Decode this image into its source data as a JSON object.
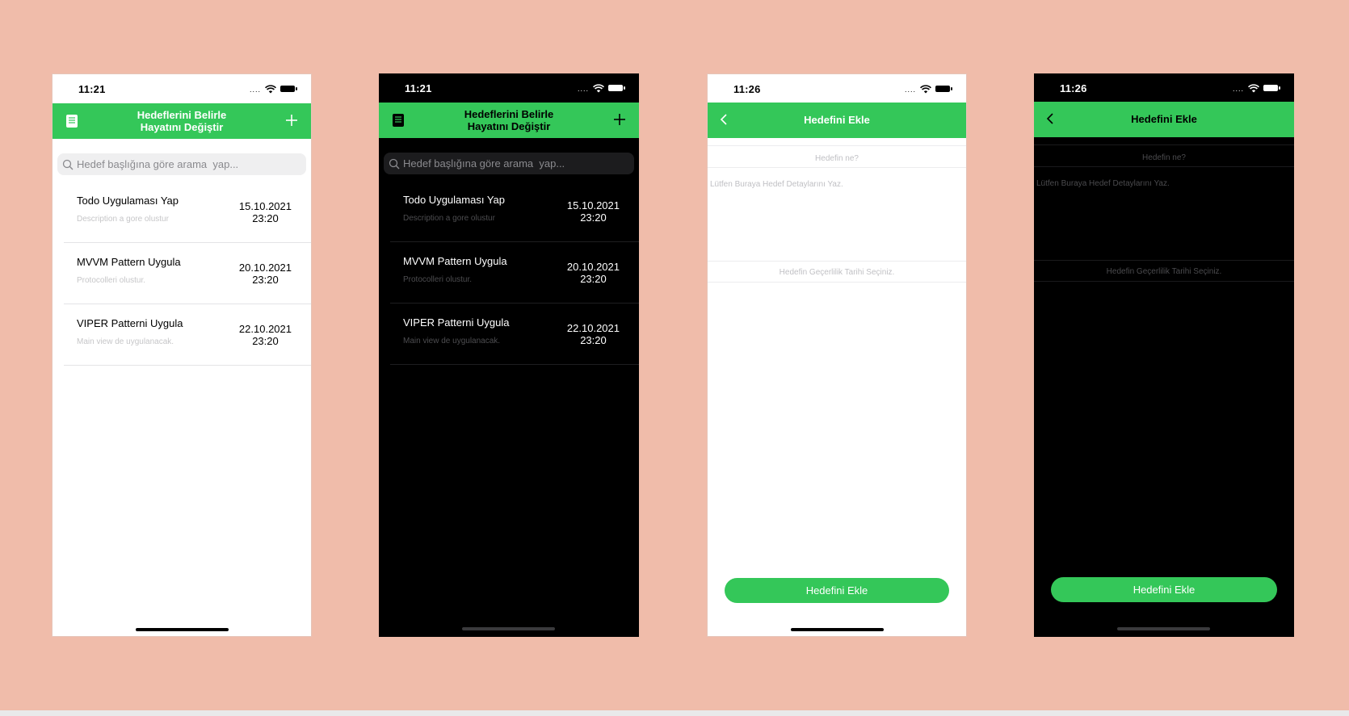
{
  "colors": {
    "background": "#f0bcaa",
    "accent": "#34c759",
    "light_bg": "#ffffff",
    "dark_bg": "#000000"
  },
  "screens": [
    {
      "theme": "light",
      "time": "11:21",
      "signal": "....",
      "nav_title_line1": "Hedeflerini Belirle",
      "nav_title_line2": "Hayatını Değiştir",
      "search_placeholder": "Hedef başlığına göre arama  yap...",
      "items": [
        {
          "title": "Todo Uygulaması Yap",
          "description": "Description a gore olustur",
          "date": "15.10.2021",
          "time": "23:20"
        },
        {
          "title": "MVVM Pattern Uygula",
          "description": "Protocolleri olustur.",
          "date": "20.10.2021",
          "time": "23:20"
        },
        {
          "title": "VIPER Patterni Uygula",
          "description": "Main view de uygulanacak.",
          "date": "22.10.2021",
          "time": "23:20"
        }
      ]
    },
    {
      "theme": "dark",
      "time": "11:21",
      "signal": "....",
      "nav_title_line1": "Hedeflerini Belirle",
      "nav_title_line2": "Hayatını Değiştir",
      "search_placeholder": "Hedef başlığına göre arama  yap...",
      "items": [
        {
          "title": "Todo Uygulaması Yap",
          "description": "Description a gore olustur",
          "date": "15.10.2021",
          "time": "23:20"
        },
        {
          "title": "MVVM Pattern Uygula",
          "description": "Protocolleri olustur.",
          "date": "20.10.2021",
          "time": "23:20"
        },
        {
          "title": "VIPER Patterni Uygula",
          "description": "Main view de uygulanacak.",
          "date": "22.10.2021",
          "time": "23:20"
        }
      ]
    },
    {
      "theme": "light",
      "time": "11:26",
      "signal": "....",
      "nav_title": "Hedefini Ekle",
      "goal_placeholder": "Hedefin ne?",
      "detail_placeholder": "Lütfen Buraya Hedef Detaylarını Yaz.",
      "date_placeholder": "Hedefin Geçerlilik Tarihi Seçiniz.",
      "button_label": "Hedefini Ekle"
    },
    {
      "theme": "dark",
      "time": "11:26",
      "signal": "....",
      "nav_title": "Hedefini Ekle",
      "goal_placeholder": "Hedefin ne?",
      "detail_placeholder": "Lütfen Buraya Hedef Detaylarını Yaz.",
      "date_placeholder": "Hedefin Geçerlilik Tarihi Seçiniz.",
      "button_label": "Hedefini Ekle"
    }
  ]
}
